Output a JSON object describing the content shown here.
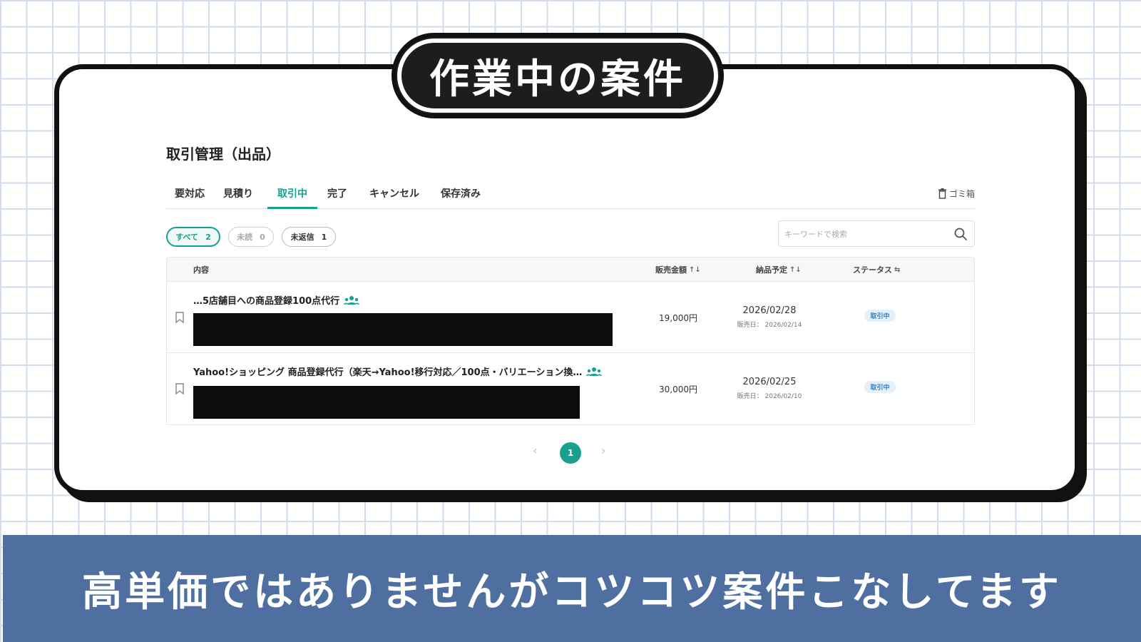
{
  "banner_title": "作業中の案件",
  "caption": "高単価ではありませんがコツコツ案件こなしてます",
  "page": {
    "heading": "取引管理（出品）",
    "tabs": [
      {
        "label": "要対応"
      },
      {
        "label": "見積り"
      },
      {
        "label": "取引中",
        "active": true
      },
      {
        "label": "完了"
      },
      {
        "label": "キャンセル"
      },
      {
        "label": "保存済み"
      }
    ],
    "trash_label": "ゴミ箱",
    "filters": [
      {
        "label": "すべて",
        "count": "2",
        "state": "active"
      },
      {
        "label": "未読",
        "count": "0",
        "state": "disabled"
      },
      {
        "label": "未返信",
        "count": "1",
        "state": "normal"
      }
    ],
    "search": {
      "placeholder": "キーワードで検索"
    },
    "table": {
      "headers": {
        "content": "内容",
        "amount": "販売金額",
        "due": "納品予定",
        "status": "ステータス"
      },
      "sort_glyph": "↑↓",
      "filter_glyph": "⇆",
      "rows": [
        {
          "title": "…5店舗目への商品登録100点代行",
          "amount": "19,000円",
          "due_date": "2026/02/28",
          "sale_date": "販売日： 2026/02/14",
          "status": "取引中"
        },
        {
          "title": "Yahoo!ショッピング 商品登録代行（楽天→Yahoo!移行対応／100点・バリエーション換…",
          "amount": "30,000円",
          "due_date": "2026/02/25",
          "sale_date": "販売日： 2026/02/10",
          "status": "取引中"
        }
      ]
    },
    "pagination": {
      "prev": "‹",
      "current": "1",
      "next": "›"
    }
  },
  "colors": {
    "accent": "#17a08d",
    "banner": "#4e6fa0",
    "status_bg": "#e4f1fb",
    "status_text": "#2f7ec4"
  }
}
